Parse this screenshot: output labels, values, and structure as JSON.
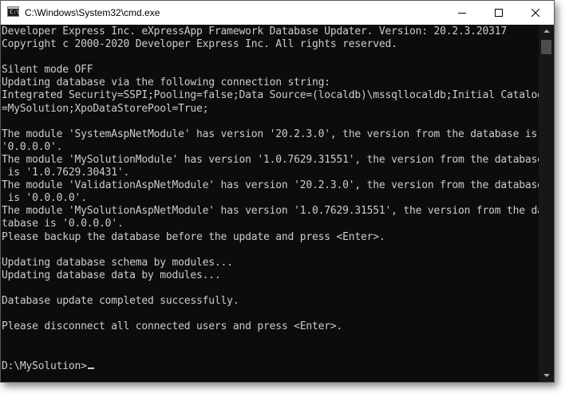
{
  "window": {
    "title": "C:\\Windows\\System32\\cmd.exe",
    "icon": "cmd-icon",
    "icon_glyph": "C:\\."
  },
  "colors": {
    "console_bg": "#0c0c0c",
    "console_text": "#cccccc",
    "titlebar_bg": "#ffffff"
  },
  "console": {
    "output": "Developer Express Inc. eXpressApp Framework Database Updater. Version: 20.2.3.20317\nCopyright c 2000-2020 Developer Express Inc. All rights reserved.\n\nSilent mode OFF\nUpdating database via the following connection string:\nIntegrated Security=SSPI;Pooling=false;Data Source=(localdb)\\mssqllocaldb;Initial Catalog\n=MySolution;XpoDataStorePool=True;\n\nThe module 'SystemAspNetModule' has version '20.2.3.0', the version from the database is\n'0.0.0.0'.\nThe module 'MySolutionModule' has version '1.0.7629.31551', the version from the database\n is '1.0.7629.30431'.\nThe module 'ValidationAspNetModule' has version '20.2.3.0', the version from the database\n is '0.0.0.0'.\nThe module 'MySolutionAspNetModule' has version '1.0.7629.31551', the version from the da\ntabase is '0.0.0.0'.\nPlease backup the database before the update and press <Enter>.\n\nUpdating database schema by modules...\nUpdating database data by modules...\n\nDatabase update completed successfully.\n\nPlease disconnect all connected users and press <Enter>.",
    "prompt": "D:\\MySolution>"
  }
}
